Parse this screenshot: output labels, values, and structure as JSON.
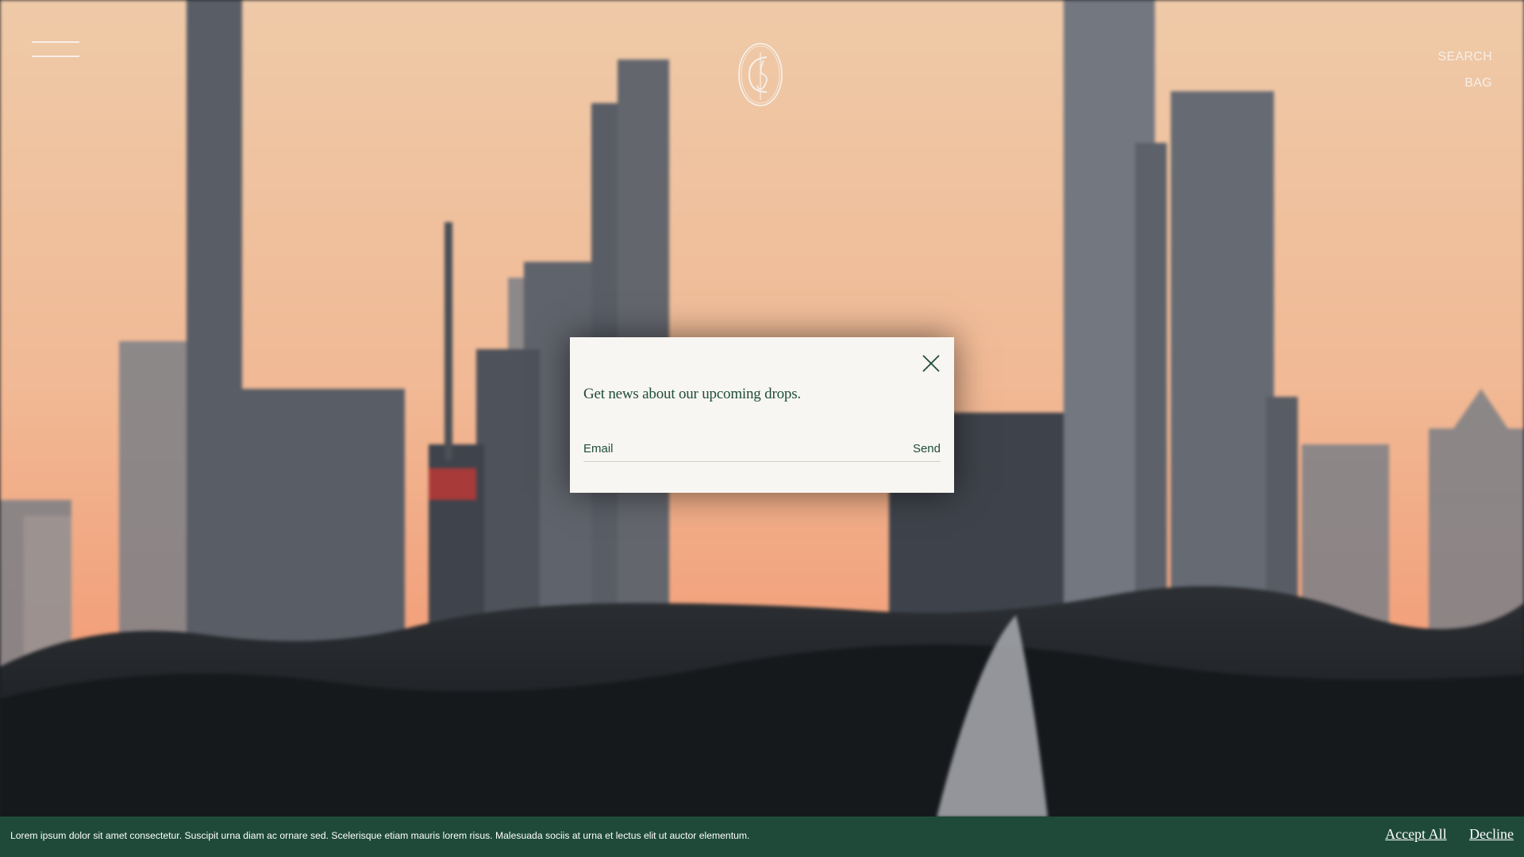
{
  "header": {
    "menu_icon": "hamburger-menu-icon",
    "logo_icon": "monogram-logo-icon",
    "links": [
      {
        "label": "SEARCH"
      },
      {
        "label": "BAG"
      }
    ]
  },
  "hero": {
    "image": "city-skyline-sunset-photo"
  },
  "newsletter_modal": {
    "title": "Get news about our upcoming drops.",
    "email_placeholder": "Email",
    "email_value": "",
    "send_label": "Send",
    "close_icon": "close-icon"
  },
  "cookie_banner": {
    "text": "Lorem ipsum dolor sit amet consectetur. Suscipit urna diam ac ornare sed. Scelerisque etiam mauris lorem risus. Malesuada sociis at urna et lectus elit ut auctor elementum.",
    "accept_label": "Accept All",
    "decline_label": "Decline"
  },
  "colors": {
    "brand_green": "#1f4d3a",
    "banner_green": "#1f4a3a",
    "modal_bg": "#f8f6f2",
    "header_text": "#f6efe8"
  }
}
